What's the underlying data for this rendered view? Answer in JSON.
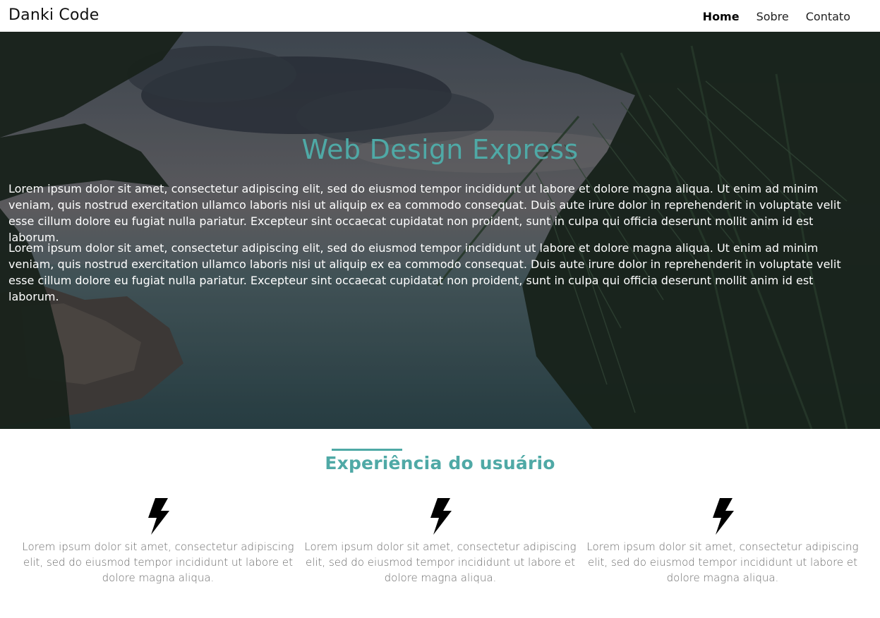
{
  "header": {
    "logo": "Danki Code",
    "nav": [
      {
        "label": "Home",
        "active": true
      },
      {
        "label": "Sobre",
        "active": false
      },
      {
        "label": "Contato",
        "active": false
      }
    ]
  },
  "hero": {
    "title": "Web Design Express",
    "paragraphs": [
      "Lorem ipsum dolor sit amet, consectetur adipiscing elit, sed do eiusmod tempor incididunt ut labore et dolore magna aliqua. Ut enim ad minim veniam, quis nostrud exercitation ullamco laboris nisi ut aliquip ex ea commodo consequat. Duis aute irure dolor in reprehenderit in voluptate velit esse cillum dolore eu fugiat nulla pariatur. Excepteur sint occaecat cupidatat non proident, sunt in culpa qui officia deserunt mollit anim id est laborum.",
      "Lorem ipsum dolor sit amet, consectetur adipiscing elit, sed do eiusmod tempor incididunt ut labore et dolore magna aliqua. Ut enim ad minim veniam, quis nostrud exercitation ullamco laboris nisi ut aliquip ex ea commodo consequat. Duis aute irure dolor in reprehenderit in voluptate velit esse cillum dolore eu fugiat nulla pariatur. Excepteur sint occaecat cupidatat non proident, sunt in culpa qui officia deserunt mollit anim id est laborum."
    ],
    "background_icon": "tropical-beach-palm-image"
  },
  "section": {
    "title": "Experiência do usuário",
    "accent_color": "#4fa9a6"
  },
  "features": [
    {
      "icon": "lightning-bolt-icon",
      "text": "Lorem ipsum dolor sit amet, consectetur adipiscing elit, sed do eiusmod tempor incididunt ut labore et dolore magna aliqua."
    },
    {
      "icon": "lightning-bolt-icon",
      "text": "Lorem ipsum dolor sit amet, consectetur adipiscing elit, sed do eiusmod tempor incididunt ut labore et dolore magna aliqua."
    },
    {
      "icon": "lightning-bolt-icon",
      "text": "Lorem ipsum dolor sit amet, consectetur adipiscing elit, sed do eiusmod tempor incididunt ut labore et dolore magna aliqua."
    }
  ]
}
